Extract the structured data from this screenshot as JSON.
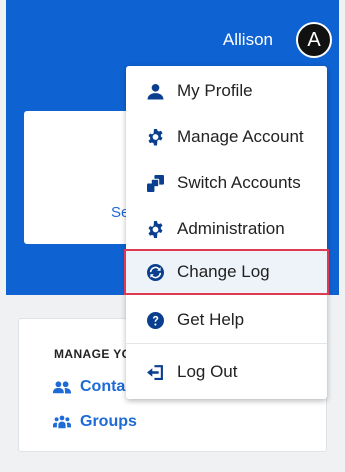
{
  "header": {
    "username": "Allison",
    "avatar_initial": "A"
  },
  "card_top": {
    "link_text": "Ser"
  },
  "manage": {
    "heading": "MANAGE YO",
    "links": [
      {
        "label": "Conta",
        "icon": "users-icon"
      },
      {
        "label": "Groups",
        "icon": "groups-icon"
      }
    ]
  },
  "menu": {
    "items": [
      {
        "label": "My Profile",
        "icon": "user-icon"
      },
      {
        "label": "Manage Account",
        "icon": "gear-icon"
      },
      {
        "label": "Switch Accounts",
        "icon": "switch-accounts-icon"
      },
      {
        "label": "Administration",
        "icon": "gear-icon"
      },
      {
        "label": "Change Log",
        "icon": "refresh-icon",
        "highlighted": true
      },
      {
        "label": "Get Help",
        "icon": "help-icon"
      },
      {
        "label": "Log Out",
        "icon": "logout-icon"
      }
    ]
  },
  "colors": {
    "brand_blue": "#0f62d2",
    "link_blue": "#1e6ad6",
    "icon_navy": "#0a3f8f",
    "highlight_border": "#e03a52"
  }
}
